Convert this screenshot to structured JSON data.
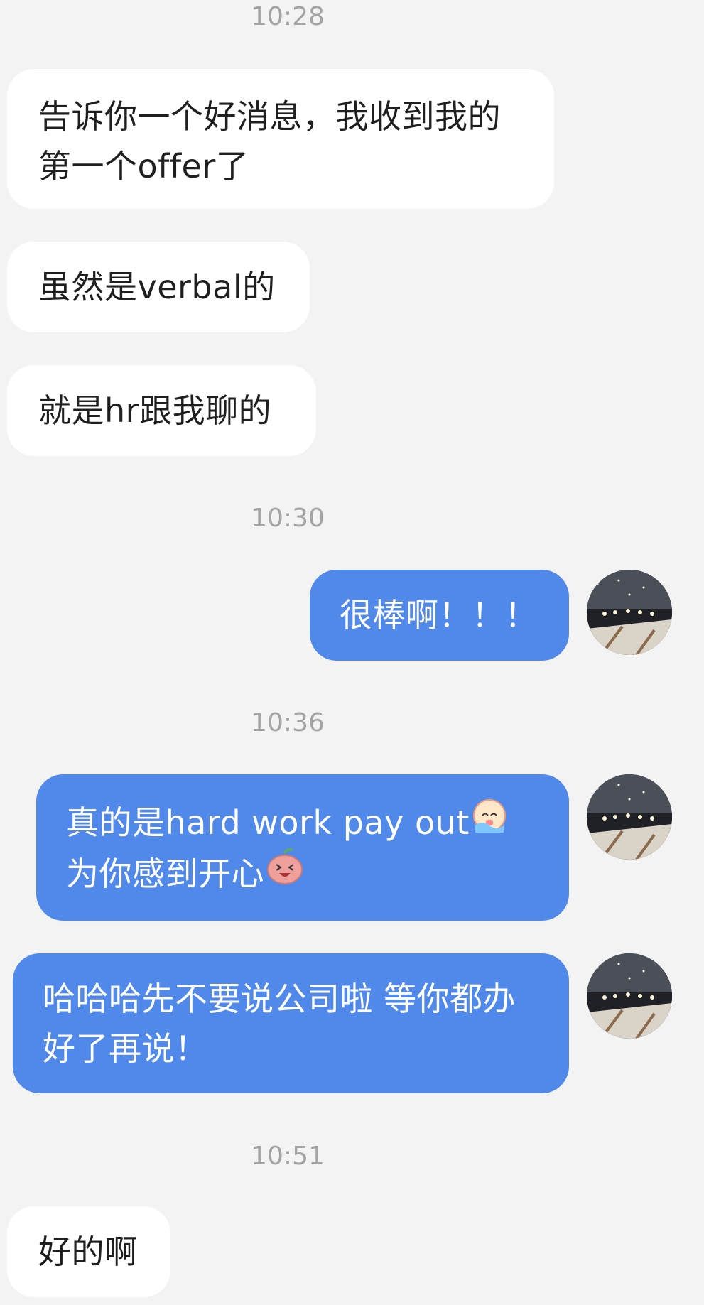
{
  "chat": {
    "messages": [
      {
        "type": "timestamp",
        "text": "10:28"
      },
      {
        "type": "incoming",
        "text": "告诉你一个好消息，我收到我的第一个offer了"
      },
      {
        "type": "incoming",
        "text": "虽然是verbal的"
      },
      {
        "type": "incoming",
        "text": "就是hr跟我聊的"
      },
      {
        "type": "timestamp",
        "text": "10:30"
      },
      {
        "type": "outgoing",
        "text": "很棒啊！！！"
      },
      {
        "type": "timestamp",
        "text": "10:36"
      },
      {
        "type": "outgoing",
        "text_part1": "真的是hard work pay out",
        "emoji1": "crying-emoji",
        "text_part2": " 为你感到开心",
        "emoji2": "laughing-peach-emoji"
      },
      {
        "type": "outgoing",
        "text": "哈哈哈先不要说公司啦 等你都办好了再说！"
      },
      {
        "type": "timestamp",
        "text": "10:51"
      },
      {
        "type": "incoming",
        "text": "好的啊"
      }
    ]
  },
  "colors": {
    "background": "#f3f3f3",
    "incoming_bubble": "#ffffff",
    "outgoing_bubble": "#5189ea",
    "timestamp": "#a3a3a3"
  },
  "avatar": {
    "icon": "user-avatar-night-snow-photo"
  }
}
